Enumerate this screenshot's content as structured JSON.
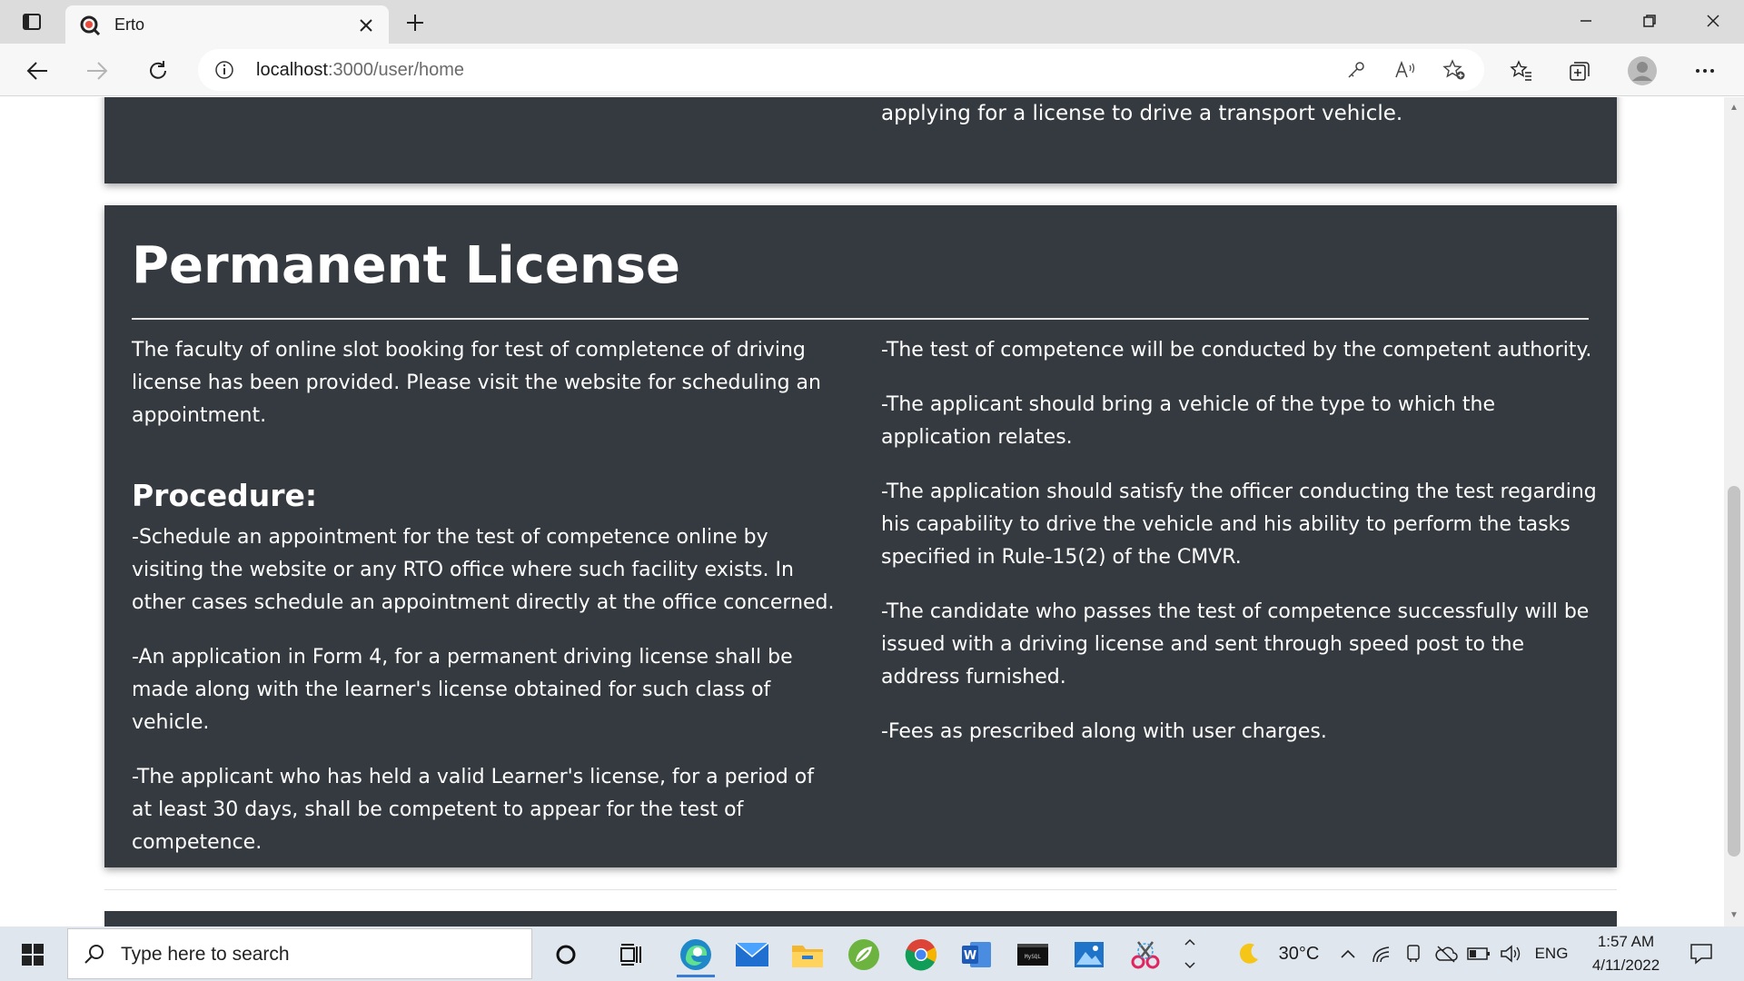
{
  "browser": {
    "tab_title": "Erto",
    "url_host": "localhost",
    "url_path": ":3000/user/home"
  },
  "page": {
    "prev_card_tail": "applying for a license to drive a transport vehicle.",
    "heading": "Permanent License",
    "intro": "The faculty of online slot booking for test of completence of driving license has been provided. Please visit the website for scheduling an appointment.",
    "procedure_heading": "Procedure:",
    "left_items": [
      "-Schedule an appointment for the test of competence online by visiting the website or any RTO office where such facility exists. In other cases schedule an appointment directly at the office concerned.",
      "-An application in Form 4, for a permanent driving license shall be made along with the learner's license obtained for such class of vehicle.",
      "-The applicant who has held a valid Learner's license, for a period of at least 30 days, shall be competent to appear for the test of competence."
    ],
    "right_items": [
      "-The test of competence will be conducted by the competent authority.",
      "-The applicant should bring a vehicle of the type to which the application relates.",
      "-The application should satisfy the officer conducting the test regarding his capability to drive the vehicle and his ability to perform the tasks specified in Rule-15(2) of the CMVR.",
      "-The candidate who passes the test of competence successfully will be issued with a driving license and sent through speed post to the address furnished.",
      "-Fees as prescribed along with user charges."
    ]
  },
  "taskbar": {
    "search_placeholder": "Type here to search",
    "temperature": "30°C",
    "language": "ENG",
    "time": "1:57 AM",
    "date": "4/11/2022"
  },
  "colors": {
    "card_bg": "#343a40",
    "card_text": "#ffffff",
    "taskbar_bg": "#dfe6ee"
  }
}
